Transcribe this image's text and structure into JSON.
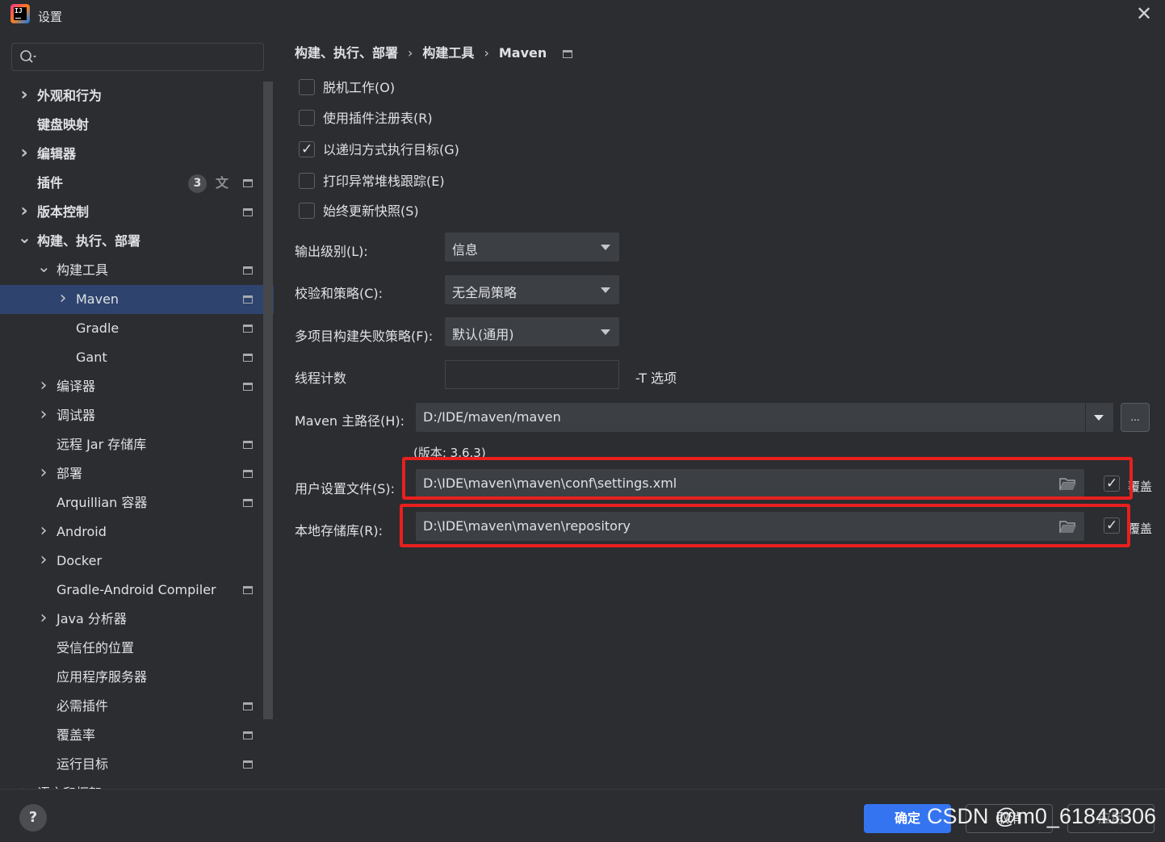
{
  "window": {
    "title": "设置",
    "close_glyph": "✕"
  },
  "search": {
    "value": "",
    "placeholder": ""
  },
  "tree": {
    "items": [
      {
        "label": "外观和行为",
        "expand": "collapsed"
      },
      {
        "label": "键盘映射",
        "expand": "none"
      },
      {
        "label": "编辑器",
        "expand": "collapsed"
      },
      {
        "label": "插件",
        "expand": "none",
        "badge": "3"
      },
      {
        "label": "版本控制",
        "expand": "collapsed"
      },
      {
        "label": "构建、执行、部署",
        "expand": "expanded"
      },
      {
        "label": "构建工具",
        "expand": "expanded"
      },
      {
        "label": "Maven",
        "expand": "collapsed",
        "selected": true
      },
      {
        "label": "Gradle",
        "expand": "none"
      },
      {
        "label": "Gant",
        "expand": "none"
      },
      {
        "label": "编译器",
        "expand": "collapsed"
      },
      {
        "label": "调试器",
        "expand": "collapsed"
      },
      {
        "label": "远程 Jar 存储库",
        "expand": "none"
      },
      {
        "label": "部署",
        "expand": "collapsed"
      },
      {
        "label": "Arquillian 容器",
        "expand": "none"
      },
      {
        "label": "Android",
        "expand": "collapsed"
      },
      {
        "label": "Docker",
        "expand": "collapsed"
      },
      {
        "label": "Gradle-Android Compiler",
        "expand": "none"
      },
      {
        "label": "Java 分析器",
        "expand": "collapsed"
      },
      {
        "label": "受信任的位置",
        "expand": "none"
      },
      {
        "label": "应用程序服务器",
        "expand": "none"
      },
      {
        "label": "必需插件",
        "expand": "none"
      },
      {
        "label": "覆盖率",
        "expand": "none"
      },
      {
        "label": "运行目标",
        "expand": "none"
      },
      {
        "label": "语言和框架",
        "expand": "collapsed"
      }
    ]
  },
  "breadcrumb": {
    "part1": "构建、执行、部署",
    "part2": "构建工具",
    "part3": "Maven",
    "sep": "›"
  },
  "options": {
    "offline": {
      "label": "脱机工作(O)",
      "checked": false
    },
    "plugin_registry": {
      "label": "使用插件注册表(R)",
      "checked": false
    },
    "recursive": {
      "label": "以递归方式执行目标(G)",
      "checked": true
    },
    "stacktrace": {
      "label": "打印异常堆栈跟踪(E)",
      "checked": false
    },
    "update_snapshots": {
      "label": "始终更新快照(S)",
      "checked": false
    }
  },
  "fields": {
    "output_level": {
      "label": "输出级别(L):",
      "value": "信息"
    },
    "checksum_policy": {
      "label": "校验和策略(C):",
      "value": "无全局策略"
    },
    "fail_policy": {
      "label": "多项目构建失败策略(F):",
      "value": "默认(通用)"
    },
    "thread_count": {
      "label": "线程计数",
      "value": "",
      "hint": "-T 选项"
    },
    "maven_home": {
      "label": "Maven 主路径(H):",
      "value": "D:/IDE/maven/maven",
      "browse": "...",
      "version": "(版本: 3.6.3)"
    },
    "user_settings": {
      "label": "用户设置文件(S):",
      "value": "D:\\IDE\\maven\\maven\\conf\\settings.xml",
      "override_label": "覆盖",
      "override": true
    },
    "local_repo": {
      "label": "本地存储库(R):",
      "value": "D:\\IDE\\maven\\maven\\repository",
      "override_label": "覆盖",
      "override": true
    }
  },
  "footer": {
    "help": "?",
    "ok": "确定",
    "cancel": "取消",
    "apply": "应用"
  },
  "watermark": "CSDN @m0_61843306",
  "colors": {
    "accent": "#3574f0",
    "selected_row": "#2e436e",
    "highlight": "#e8201f",
    "background": "#2b2d30"
  }
}
